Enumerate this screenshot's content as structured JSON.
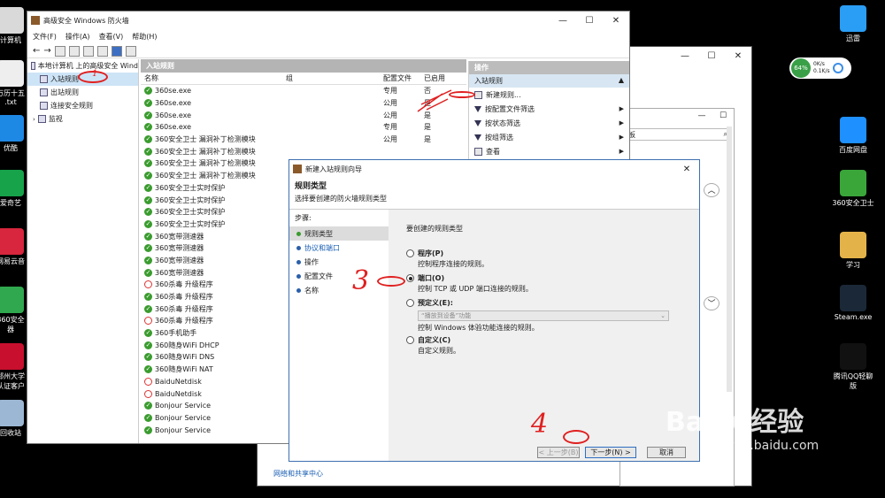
{
  "desktop": {
    "left_icons": [
      {
        "label": "计算机",
        "icon": "computer-icon"
      },
      {
        "label": "万历十五\n.txt",
        "icon": "text-file-icon"
      },
      {
        "label": "优酷",
        "icon": "youku-icon"
      },
      {
        "label": "爱奇艺",
        "icon": "iqiyi-icon"
      },
      {
        "label": "网易云音",
        "icon": "netease-music-icon"
      },
      {
        "label": "360安全\n器",
        "icon": "360-browser-icon"
      },
      {
        "label": "郑州大学\n认证客户",
        "icon": "zzu-client-icon"
      },
      {
        "label": "回收站",
        "icon": "recycle-bin-icon"
      }
    ],
    "right_icons": [
      {
        "label": "迅雷",
        "icon": "xunlei-icon"
      },
      {
        "label": "百度网盘",
        "icon": "baidu-netdisk-icon"
      },
      {
        "label": "360安全卫士",
        "icon": "360-safe-icon"
      },
      {
        "label": "学习",
        "icon": "folder-icon"
      },
      {
        "label": "Steam.exe",
        "icon": "steam-icon"
      },
      {
        "label": "腾讯QQ轻聊\n版",
        "icon": "qq-icon"
      }
    ],
    "speed_widget": {
      "percent": "64%",
      "up": "0K/s",
      "down": "0.1K/s"
    },
    "watermark": {
      "brand": "Baidu经验",
      "url": "jingyan.baidu.com"
    }
  },
  "bg_window": {
    "footer_text": "网络和共享中心",
    "search_placeholder": "板"
  },
  "firewall": {
    "title": "高级安全 Windows 防火墙",
    "menu": [
      "文件(F)",
      "操作(A)",
      "查看(V)",
      "帮助(H)"
    ],
    "tree": {
      "root": "本地计算机 上的高级安全 Wind",
      "items": [
        "入站规则",
        "出站规则",
        "连接安全规则",
        "监视"
      ]
    },
    "center_header": "入站规则",
    "columns": [
      "名称",
      "组",
      "配置文件",
      "已启用"
    ],
    "rules": [
      {
        "name": "360se.exe",
        "profile": "专用",
        "enabled": "否",
        "allow": true
      },
      {
        "name": "360se.exe",
        "profile": "公用",
        "enabled": "是",
        "allow": true
      },
      {
        "name": "360se.exe",
        "profile": "公用",
        "enabled": "是",
        "allow": true
      },
      {
        "name": "360se.exe",
        "profile": "专用",
        "enabled": "是",
        "allow": true
      },
      {
        "name": "360安全卫士 漏洞补丁检测模块",
        "profile": "公用",
        "enabled": "是",
        "allow": true
      },
      {
        "name": "360安全卫士 漏洞补丁检测模块",
        "profile": "",
        "enabled": "",
        "allow": true
      },
      {
        "name": "360安全卫士 漏洞补丁检测模块",
        "profile": "",
        "enabled": "",
        "allow": true
      },
      {
        "name": "360安全卫士 漏洞补丁检测模块",
        "profile": "",
        "enabled": "",
        "allow": true
      },
      {
        "name": "360安全卫士实时保护",
        "profile": "",
        "enabled": "",
        "allow": true
      },
      {
        "name": "360安全卫士实时保护",
        "profile": "",
        "enabled": "",
        "allow": true
      },
      {
        "name": "360安全卫士实时保护",
        "profile": "",
        "enabled": "",
        "allow": true
      },
      {
        "name": "360安全卫士实时保护",
        "profile": "",
        "enabled": "",
        "allow": true
      },
      {
        "name": "360宽带测速器",
        "profile": "",
        "enabled": "",
        "allow": true
      },
      {
        "name": "360宽带测速器",
        "profile": "",
        "enabled": "",
        "allow": true
      },
      {
        "name": "360宽带测速器",
        "profile": "",
        "enabled": "",
        "allow": true
      },
      {
        "name": "360宽带测速器",
        "profile": "",
        "enabled": "",
        "allow": true
      },
      {
        "name": "360杀毒 升级程序",
        "profile": "",
        "enabled": "",
        "allow": false
      },
      {
        "name": "360杀毒 升级程序",
        "profile": "",
        "enabled": "",
        "allow": true
      },
      {
        "name": "360杀毒 升级程序",
        "profile": "",
        "enabled": "",
        "allow": true
      },
      {
        "name": "360杀毒 升级程序",
        "profile": "",
        "enabled": "",
        "allow": false
      },
      {
        "name": "360手机助手",
        "profile": "",
        "enabled": "",
        "allow": true
      },
      {
        "name": "360随身WiFi DHCP",
        "profile": "",
        "enabled": "",
        "allow": true
      },
      {
        "name": "360随身WiFi DNS",
        "profile": "",
        "enabled": "",
        "allow": true
      },
      {
        "name": "360随身WiFi NAT",
        "profile": "",
        "enabled": "",
        "allow": true
      },
      {
        "name": "BaiduNetdisk",
        "profile": "",
        "enabled": "",
        "allow": false
      },
      {
        "name": "BaiduNetdisk",
        "profile": "",
        "enabled": "",
        "allow": false
      },
      {
        "name": "Bonjour Service",
        "profile": "",
        "enabled": "",
        "allow": true
      },
      {
        "name": "Bonjour Service",
        "profile": "",
        "enabled": "",
        "allow": true
      },
      {
        "name": "Bonjour Service",
        "profile": "",
        "enabled": "",
        "allow": true
      }
    ],
    "actions_header": "操作",
    "actions_sub": "入站规则",
    "actions": [
      {
        "label": "新建规则...",
        "icon": "new-rule-icon",
        "arrow": false
      },
      {
        "label": "按配置文件筛选",
        "icon": "filter-icon",
        "arrow": true
      },
      {
        "label": "按状态筛选",
        "icon": "filter-icon",
        "arrow": true
      },
      {
        "label": "按组筛选",
        "icon": "filter-icon",
        "arrow": true
      },
      {
        "label": "查看",
        "icon": "view-icon",
        "arrow": true
      }
    ]
  },
  "wizard": {
    "title": "新建入站规则向导",
    "heading": "规则类型",
    "subheading": "选择要创建的防火墙规则类型",
    "steps_label": "步骤:",
    "steps": [
      "规则类型",
      "协议和端口",
      "操作",
      "配置文件",
      "名称"
    ],
    "question": "要创建的规则类型",
    "options": [
      {
        "label": "程序(P)",
        "desc": "控制程序连接的规则。",
        "selected": false
      },
      {
        "label": "端口(O)",
        "desc": "控制 TCP 或 UDP 端口连接的规则。",
        "selected": true
      },
      {
        "label": "预定义(E):",
        "desc": "控制 Windows 体验功能连接的规则。",
        "selected": false,
        "dropdown": "“播放到设备”功能"
      },
      {
        "label": "自定义(C)",
        "desc": "自定义规则。",
        "selected": false
      }
    ],
    "buttons": {
      "back": "< 上一步(B)",
      "next": "下一步(N) >",
      "cancel": "取消"
    }
  },
  "annotations": {
    "n1": "1",
    "n3": "3",
    "n4": "4"
  }
}
